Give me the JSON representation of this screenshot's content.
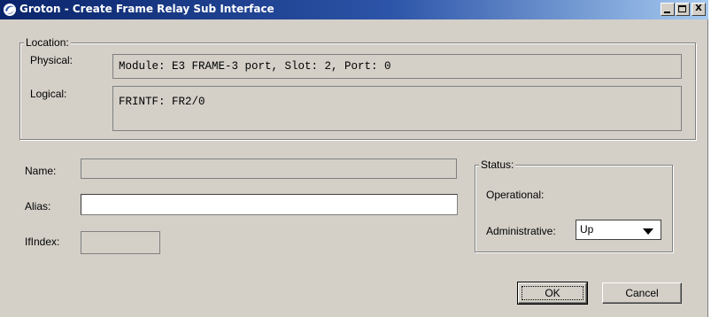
{
  "window": {
    "title": "Groton - Create Frame Relay Sub Interface",
    "controls": {
      "minimize": "minimize",
      "maximize": "maximize",
      "close": "X"
    }
  },
  "location": {
    "legend": "Location:",
    "physical_label": "Physical:",
    "physical_value": "Module: E3 FRAME-3 port, Slot: 2, Port: 0",
    "logical_label": "Logical:",
    "logical_value": "FRINTF: FR2/0"
  },
  "form": {
    "name_label": "Name:",
    "name_value": "",
    "alias_label": "Alias:",
    "alias_value": "",
    "ifindex_label": "IfIndex:",
    "ifindex_value": ""
  },
  "status": {
    "legend": "Status:",
    "operational_label": "Operational:",
    "operational_value": "",
    "administrative_label": "Administrative:",
    "administrative_value": "Up"
  },
  "buttons": {
    "ok": "OK",
    "cancel": "Cancel"
  }
}
